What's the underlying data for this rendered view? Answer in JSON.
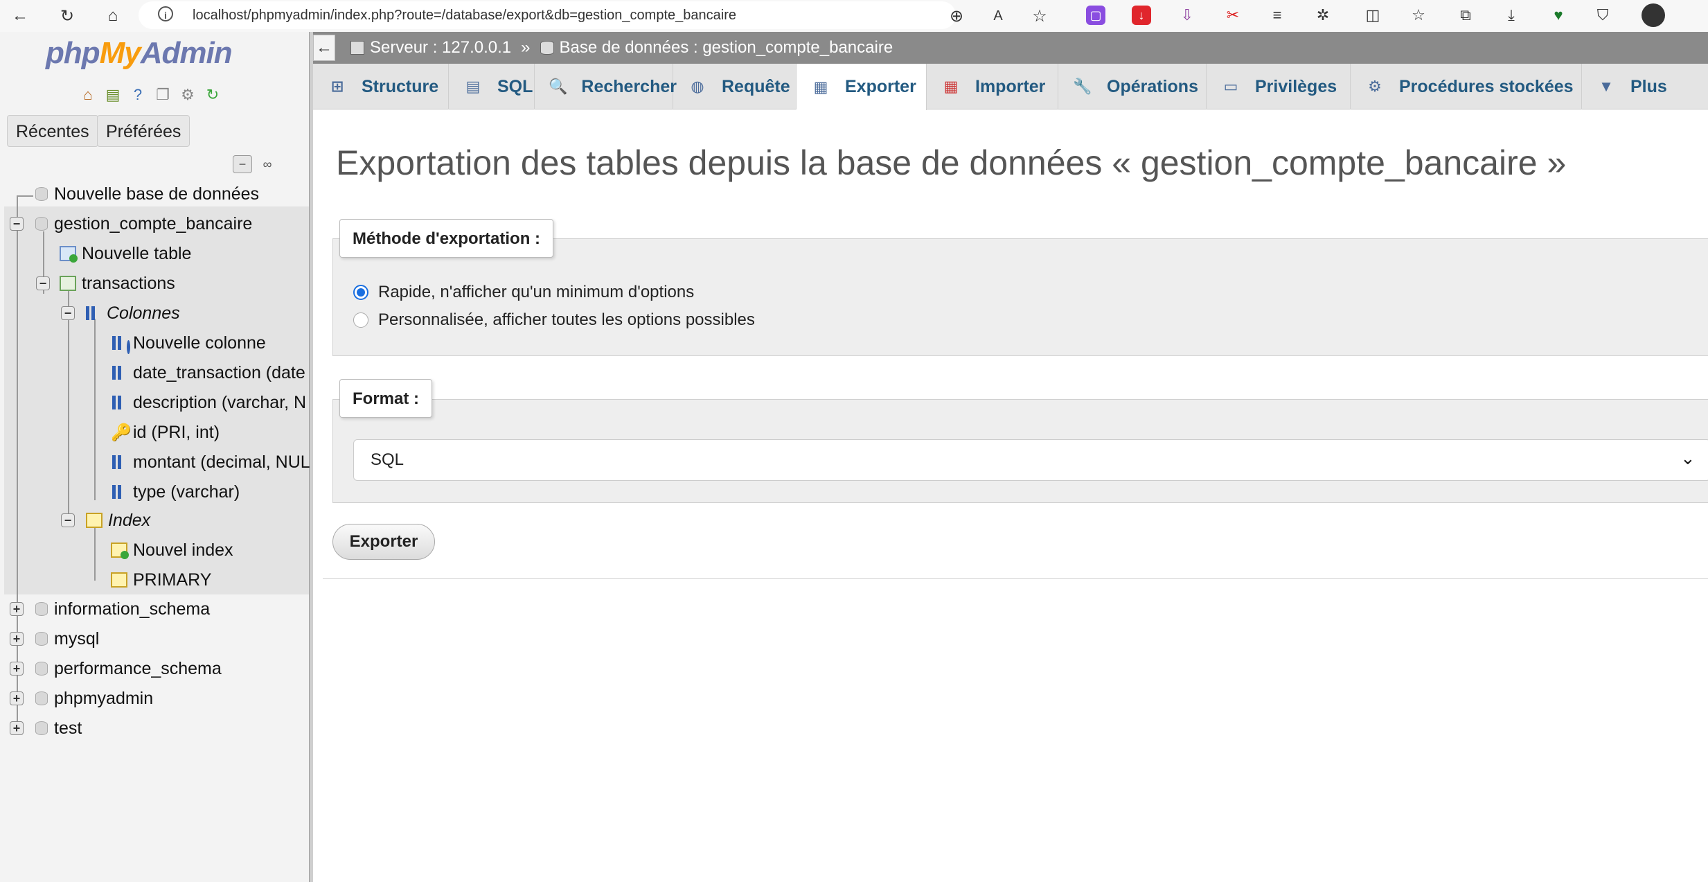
{
  "browser": {
    "url": "localhost/phpmyadmin/index.php?route=/database/export&db=gestion_compte_bancaire",
    "back_icon": "←",
    "reload_icon": "↻",
    "home_icon": "⌂"
  },
  "sidebar": {
    "logo": {
      "php": "php",
      "my": "My",
      "admin": "Admin"
    },
    "tabs": [
      "Récentes",
      "Préférées"
    ],
    "tree": {
      "new_db": "Nouvelle base de données",
      "db_name": "gestion_compte_bancaire",
      "new_table": "Nouvelle table",
      "table_name": "transactions",
      "columns_label": "Colonnes",
      "new_column": "Nouvelle colonne",
      "columns": [
        "date_transaction (date",
        "description (varchar, N",
        "id (PRI, int)",
        "montant (decimal, NUL",
        "type (varchar)"
      ],
      "index_label": "Index",
      "new_index": "Nouvel index",
      "index_primary": "PRIMARY",
      "other_dbs": [
        "information_schema",
        "mysql",
        "performance_schema",
        "phpmyadmin",
        "test"
      ]
    }
  },
  "breadcrumb": {
    "server": "Serveur : 127.0.0.1",
    "separator": "»",
    "database": "Base de données : gestion_compte_bancaire"
  },
  "tabs": [
    {
      "label": "Structure",
      "icon": "structure-icon"
    },
    {
      "label": "SQL",
      "icon": "sql-icon"
    },
    {
      "label": "Rechercher",
      "icon": "search-icon"
    },
    {
      "label": "Requête",
      "icon": "query-icon"
    },
    {
      "label": "Exporter",
      "icon": "export-icon",
      "active": true
    },
    {
      "label": "Importer",
      "icon": "import-icon"
    },
    {
      "label": "Opérations",
      "icon": "wrench-icon"
    },
    {
      "label": "Privilèges",
      "icon": "privileges-icon"
    },
    {
      "label": "Procédures stockées",
      "icon": "routines-icon"
    },
    {
      "label": "Plus",
      "icon": "chevron-down-icon"
    }
  ],
  "main": {
    "title": "Exportation des tables depuis la base de données « gestion_compte_bancaire »",
    "method_legend": "Méthode d'exportation :",
    "method_quick": "Rapide, n'afficher qu'un minimum d'options",
    "method_custom": "Personnalisée, afficher toutes les options possibles",
    "format_legend": "Format :",
    "format_value": "SQL",
    "export_button": "Exporter"
  }
}
